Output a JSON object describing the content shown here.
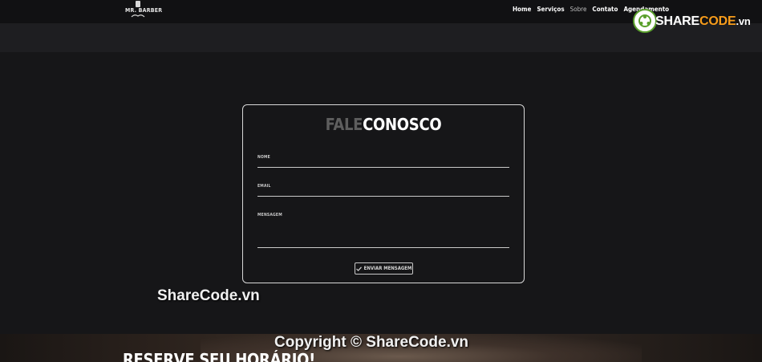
{
  "header": {
    "logo_text": "MR. BARBER",
    "nav": [
      {
        "label": "Home",
        "muted": false
      },
      {
        "label": "Serviços",
        "muted": false
      },
      {
        "label": "Sobre",
        "muted": true
      },
      {
        "label": "Contato",
        "muted": false
      },
      {
        "label": "Agendamento",
        "muted": false
      }
    ]
  },
  "sharecode_logo": {
    "share": "SHARE",
    "code": "CODE",
    "vn": ".vn"
  },
  "contact_form": {
    "title_part1": "FALE",
    "title_part2": "CONOSCO",
    "fields": {
      "name_label": "NOME",
      "email_label": "EMAIL",
      "message_label": "MENSAGEM"
    },
    "submit_label": "ENVIAR MENSAGEM"
  },
  "watermarks": {
    "site": "ShareCode.vn",
    "copyright": "Copyright © ShareCode.vn"
  },
  "reserve_section": {
    "heading": "RESERVE SEU HORÁRIO!"
  },
  "colors": {
    "background": "#161618",
    "topbar": "#111113",
    "subbar": "#1e1e21",
    "sharecode_orange": "#f79c1b",
    "sharecode_green": "#5aa02c"
  }
}
